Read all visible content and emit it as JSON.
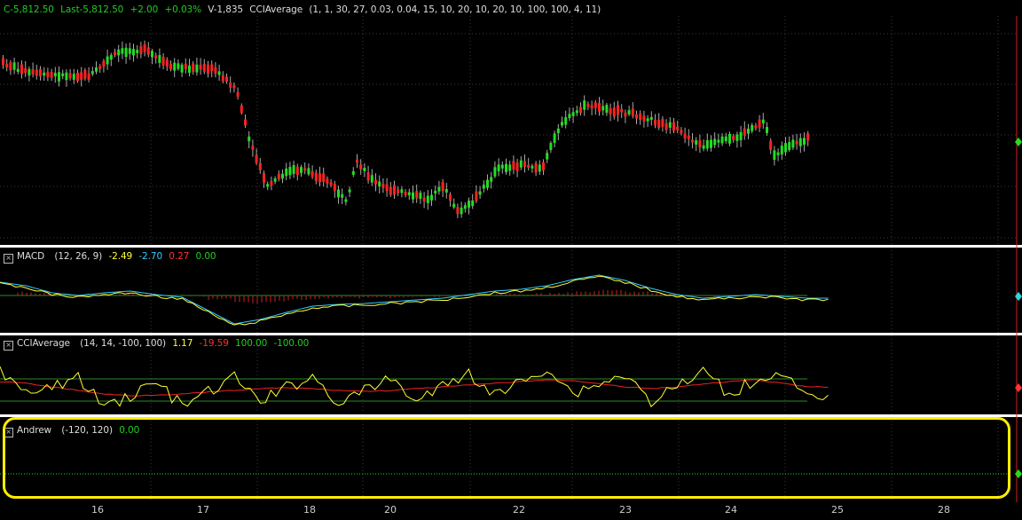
{
  "price_header": {
    "close": "C-5,812.50",
    "last": "Last-5,812.50",
    "change": "+2.00",
    "change_pct": "+0.03%",
    "volume": "V-1,835",
    "study_name": "CCIAverage",
    "study_params": "(1, 1, 30, 27, 0.03, 0.04, 15, 10, 20, 10, 20, 10, 100, 100, 4, 11)"
  },
  "macd_panel": {
    "name": "MACD",
    "params": "(12, 26, 9)",
    "values": [
      "-2.49",
      "-2.70",
      "0.27",
      "0.00"
    ]
  },
  "cci_panel": {
    "name": "CCIAverage",
    "params": "(14, 14, -100, 100)",
    "values": [
      "1.17",
      "-19.59",
      "100.00",
      "-100.00"
    ]
  },
  "andrew_panel": {
    "name": "Andrew",
    "params": "(-120, 120)",
    "value": "0.00"
  },
  "x_axis": {
    "labels": [
      "16",
      "17",
      "18",
      "20",
      "22",
      "23",
      "24",
      "25",
      "28"
    ]
  },
  "colors": {
    "up": "#22dd22",
    "down": "#ff2222",
    "yellow": "#ffff33",
    "cyan": "#33ccff",
    "separator": "#ffffff",
    "highlight": "#ffee00"
  }
}
